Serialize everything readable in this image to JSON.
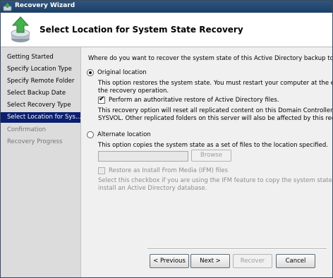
{
  "window": {
    "title": "Recovery Wizard"
  },
  "header": {
    "title": "Select Location for System State Recovery"
  },
  "sidebar": {
    "steps": [
      {
        "label": "Getting Started"
      },
      {
        "label": "Specify Location Type"
      },
      {
        "label": "Specify Remote Folder"
      },
      {
        "label": "Select Backup Date"
      },
      {
        "label": "Select Recovery Type"
      },
      {
        "label": "Select Location for Sys..."
      },
      {
        "label": "Confirmation"
      },
      {
        "label": "Recovery Progress"
      }
    ],
    "active_index": 5
  },
  "content": {
    "question": "Where do you want to recover the system state of this Active Directory backup to?",
    "original": {
      "label": "Original location",
      "selected": true,
      "desc_line1": "This option restores the system state. You must restart your computer at the end of",
      "desc_line2": "the recovery operation.",
      "authoritative_label": "Perform an authoritative restore of Active Directory files.",
      "authoritative_checked": true,
      "note_line1": "This recovery option will reset all replicated content on this Domain Controller including",
      "note_line2": "SYSVOL. Other replicated folders on this server will also be affected by this recovery."
    },
    "alternate": {
      "label": "Alternate location",
      "selected": false,
      "desc": "This option copies the system state as a set of files to the location specified.",
      "path_value": "",
      "browse_label": "Browse",
      "ifm_label": "Restore as Install From Media (IFM) files",
      "ifm_checked": false,
      "ifm_desc_line1": "Select this checkbox if you are using the IFM feature to copy the system state files to",
      "ifm_desc_line2": "install an Active Directory database."
    }
  },
  "footer": {
    "previous_label": "< Previous",
    "next_label": "Next >",
    "recover_label": "Recover",
    "cancel_label": "Cancel"
  },
  "colors": {
    "titlebar": "#2f5680",
    "sidebar_bg": "#dcdcdc",
    "active_step_bg": "#0a1f6f"
  }
}
